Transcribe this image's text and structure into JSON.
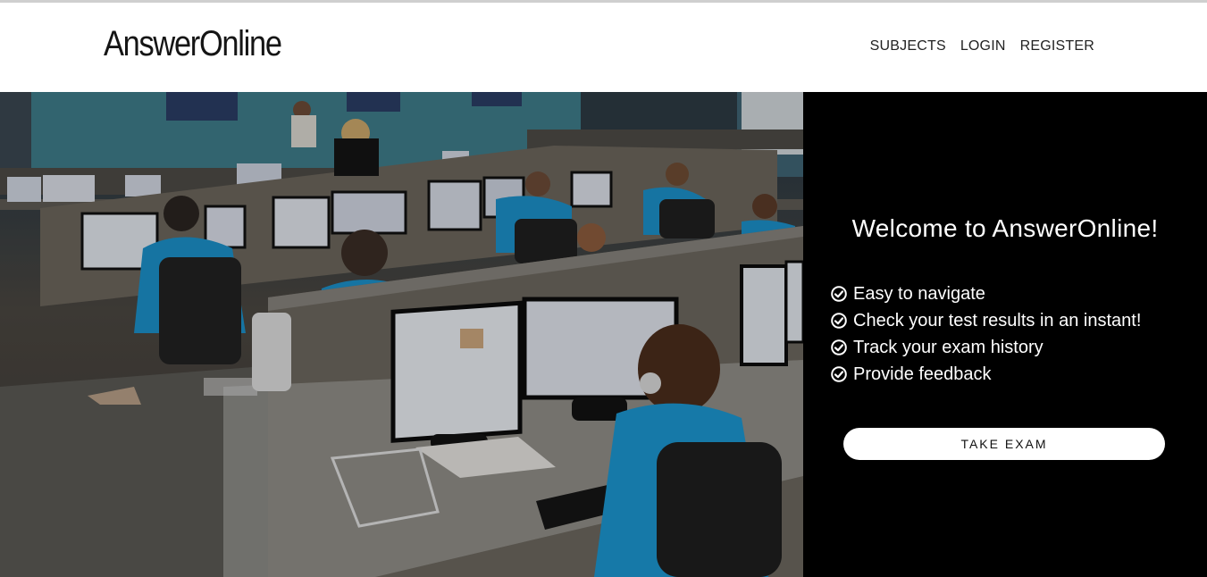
{
  "brand": {
    "title": "AnswerOnline"
  },
  "nav": {
    "subjects": "SUBJECTS",
    "login": "LOGIN",
    "register": "REGISTER"
  },
  "hero": {
    "welcome": "Welcome to AnswerOnline!",
    "features": [
      "Easy to navigate",
      "Check your test results in an instant!",
      "Track your exam history",
      "Provide feedback"
    ],
    "cta": "TAKE EXAM",
    "photo_icon": "testing-center-photo",
    "feature_icon": "check-circle-icon"
  },
  "colors": {
    "panel_bg": "#000000",
    "panel_text": "#ffffff",
    "navbar_bg": "#ffffff",
    "accent_shirts": "#1b9ad8"
  }
}
